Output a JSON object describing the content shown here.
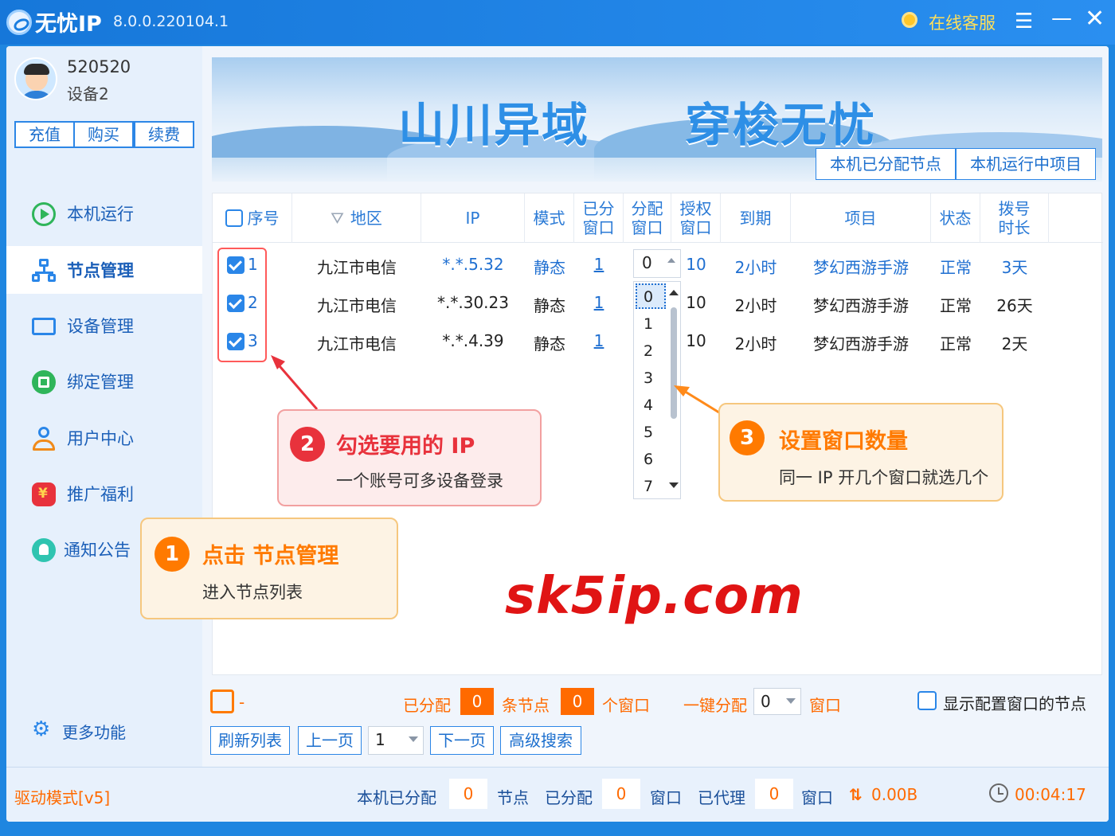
{
  "titlebar": {
    "app_name": "无忧IP",
    "version": "8.0.0.220104.1",
    "customer_service": "在线客服"
  },
  "user": {
    "id": "520520",
    "device": "设备2"
  },
  "account_buttons": [
    "充值",
    "购买",
    "续费"
  ],
  "sidebar": {
    "items": [
      {
        "label": "本机运行",
        "icon": "play-icon"
      },
      {
        "label": "节点管理",
        "icon": "node-tree-icon",
        "active": true
      },
      {
        "label": "设备管理",
        "icon": "device-icon"
      },
      {
        "label": "绑定管理",
        "icon": "bind-icon"
      },
      {
        "label": "用户中心",
        "icon": "user-icon"
      },
      {
        "label": "推广福利",
        "icon": "gift-icon"
      },
      {
        "label": "通知公告",
        "icon": "bell-icon"
      }
    ],
    "more": "更多功能"
  },
  "banner": {
    "slogan_left": "山川异域",
    "slogan_right": "穿梭无忧",
    "tabs": [
      "本机已分配节点",
      "本机运行中项目"
    ]
  },
  "table": {
    "headers": {
      "seq": "序号",
      "region": "地区",
      "ip": "IP",
      "mode": "模式",
      "assigned_line1": "已分",
      "assigned_line2": "窗口",
      "allocate_line1": "分配",
      "allocate_line2": "窗口",
      "authorized_line1": "授权",
      "authorized_line2": "窗口",
      "expire": "到期",
      "project": "项目",
      "status": "状态",
      "duration_line1": "拨号",
      "duration_line2": "时长"
    },
    "rows": [
      {
        "seq": "1",
        "region": "九江市电信",
        "ip": "*.*.5.32",
        "mode": "静态",
        "assigned": "1",
        "allocate": "0",
        "authorized": "10",
        "expire": "2小时",
        "project": "梦幻西游手游",
        "status": "正常",
        "duration": "3天",
        "checked": true
      },
      {
        "seq": "2",
        "region": "九江市电信",
        "ip": "*.*.30.23",
        "mode": "静态",
        "assigned": "1",
        "authorized": "10",
        "expire": "2小时",
        "project": "梦幻西游手游",
        "status": "正常",
        "duration": "26天",
        "checked": true
      },
      {
        "seq": "3",
        "region": "九江市电信",
        "ip": "*.*.4.39",
        "mode": "静态",
        "assigned": "1",
        "authorized": "10",
        "expire": "2小时",
        "project": "梦幻西游手游",
        "status": "正常",
        "duration": "2天",
        "checked": true
      }
    ],
    "allocate_options": [
      "0",
      "1",
      "2",
      "3",
      "4",
      "5",
      "6",
      "7"
    ],
    "allocate_selected": "0"
  },
  "callouts": {
    "c1": {
      "num": "1",
      "title": "点击 节点管理",
      "sub": "进入节点列表",
      "color": "#ff7a00"
    },
    "c2": {
      "num": "2",
      "title": "勾选要用的 IP",
      "sub": "一个账号可多设备登录",
      "color": "#e8323c"
    },
    "c3": {
      "num": "3",
      "title": "设置窗口数量",
      "sub": "同一 IP 开几个窗口就选几个",
      "color": "#ff7a00"
    }
  },
  "watermark": "sk5ip.com",
  "summary": {
    "dash": "-",
    "assigned_label": "已分配",
    "nodes_value": "0",
    "nodes_unit": "条节点",
    "windows_value": "0",
    "windows_unit": "个窗口",
    "one_click_label": "一键分配",
    "one_click_value": "0",
    "one_click_unit": "窗口",
    "show_configured_label": "显示配置窗口的节点"
  },
  "pager": {
    "refresh": "刷新列表",
    "prev": "上一页",
    "page": "1",
    "next": "下一页",
    "advanced": "高级搜索"
  },
  "statusbar": {
    "driver_mode": "驱动模式[v5]",
    "local_assigned": "本机已分配",
    "local_assigned_value": "0",
    "nodes_label": "节点",
    "assigned": "已分配",
    "assigned_value": "0",
    "windows_label": "窗口",
    "proxied": "已代理",
    "proxied_value": "0",
    "windows_label2": "窗口",
    "traffic": "0.00B",
    "time": "00:04:17"
  }
}
